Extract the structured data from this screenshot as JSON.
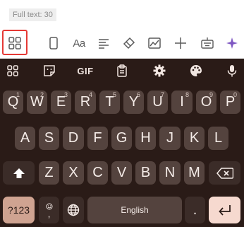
{
  "status": {
    "full_text": "Full text: 30"
  },
  "toolbar": {
    "items": [
      {
        "icon": "apps-grid-icon"
      },
      {
        "icon": "one-handed-icon"
      },
      {
        "icon": "text-style-icon",
        "label": "Aa"
      },
      {
        "icon": "align-icon"
      },
      {
        "icon": "clean-icon"
      },
      {
        "icon": "chart-icon"
      },
      {
        "icon": "plus-icon"
      },
      {
        "icon": "keyboard-icon"
      },
      {
        "icon": "sparkle-icon"
      }
    ]
  },
  "keyboard": {
    "top_row": [
      {
        "icon": "grid-icon"
      },
      {
        "icon": "emoji-sticker-icon"
      },
      {
        "icon": "gif-icon",
        "label": "GIF"
      },
      {
        "icon": "clipboard-icon"
      },
      {
        "icon": "settings-icon"
      },
      {
        "icon": "palette-icon"
      },
      {
        "icon": "mic-icon"
      }
    ],
    "row1": [
      "Q",
      "W",
      "E",
      "R",
      "T",
      "Y",
      "U",
      "I",
      "O",
      "P"
    ],
    "row1_hints": [
      "1",
      "2",
      "3",
      "4",
      "5",
      "6",
      "7",
      "8",
      "9",
      "0"
    ],
    "row2": [
      "A",
      "S",
      "D",
      "F",
      "G",
      "H",
      "J",
      "K",
      "L"
    ],
    "row3": [
      "Z",
      "X",
      "C",
      "V",
      "B",
      "N",
      "M"
    ],
    "symbols_label": "?123",
    "emoji_comma_label": ",",
    "space_label": "English",
    "period_label": "."
  },
  "colors": {
    "keyboard_bg": "#2a1b17",
    "key_bg": "#54433e",
    "accent": "#f6d9cf",
    "highlight": "#e53935"
  }
}
